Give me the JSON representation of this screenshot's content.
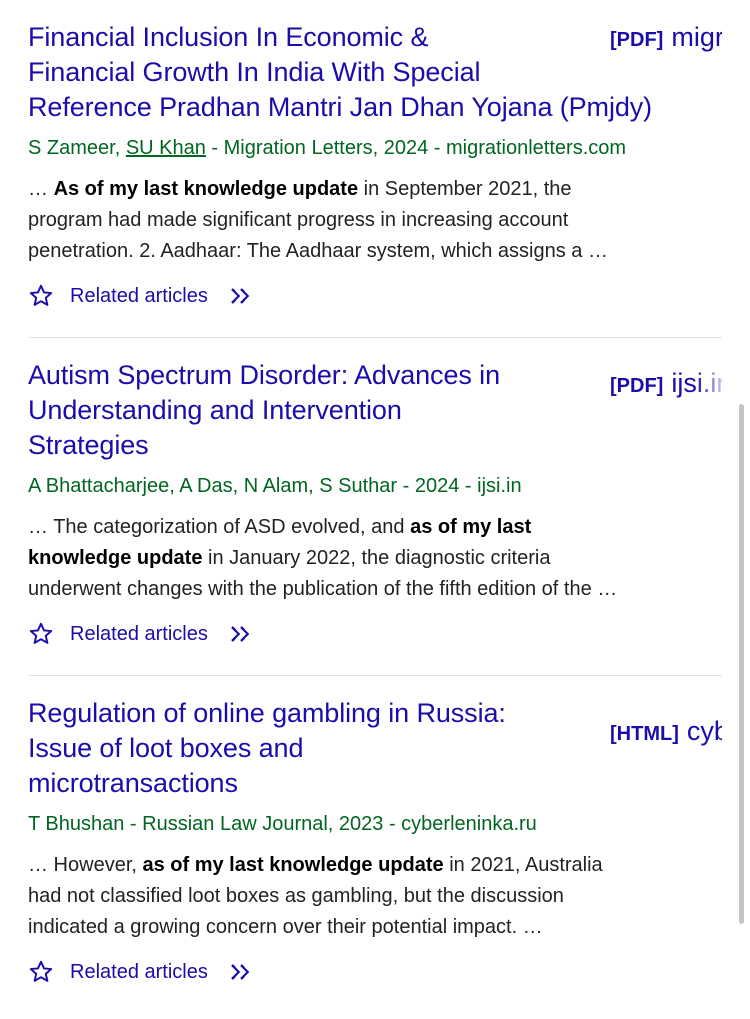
{
  "results": [
    {
      "title_lines": [
        "Financial Inclusion In Economic &",
        "Financial Growth In India With Special",
        "Reference Pradhan Mantri Jan Dhan Yojana (Pmjdy)"
      ],
      "fulltext_type": "[PDF]",
      "fulltext_domain": "migrationletters.com",
      "authors_before": "S Zameer, ",
      "author_link": "SU Khan",
      "authors_after": " - Migration Letters, 2024 - migrationletters.com",
      "snippet": {
        "l1_pre": "… ",
        "l1_bold": "As of my last knowledge update",
        "l1_post": " in September 2021, the",
        "l2": "program had made significant progress in increasing account",
        "l3": "penetration. 2. Aadhaar: The Aadhaar system, which assigns a …"
      },
      "related_label": "Related articles"
    },
    {
      "title_lines": [
        "Autism Spectrum Disorder: Advances in",
        "Understanding and Intervention",
        "Strategies"
      ],
      "fulltext_type": "[PDF]",
      "fulltext_domain": "ijsi.in",
      "authors": "A Bhattacharjee, A Das, N Alam, S Suthar - 2024 - ijsi.in",
      "snippet": {
        "l1_pre": "… The categorization of ASD evolved, and ",
        "l1_bold": "as of my last",
        "l2_bold": "knowledge update",
        "l2_post": " in January 2022, the diagnostic criteria",
        "l3": "underwent changes with the publication of the fifth edition of the …"
      },
      "related_label": "Related articles"
    },
    {
      "title_lines": [
        "Regulation of online gambling in Russia:",
        "Issue of loot boxes and",
        "microtransactions"
      ],
      "fulltext_type": "[HTML]",
      "fulltext_domain": "cyberleninka.ru",
      "authors": "T Bhushan - Russian Law Journal, 2023 - cyberleninka.ru",
      "snippet": {
        "l1_pre": "… However, ",
        "l1_bold": "as of my last knowledge update",
        "l1_post": " in 2021, Australia",
        "l2": "had not classified loot boxes as gambling, but the discussion",
        "l3": "indicated a growing concern over their potential impact. …"
      },
      "related_label": "Related articles"
    }
  ],
  "icons": {
    "star": "star-outline-icon",
    "more": "double-chevron-right-icon"
  },
  "colors": {
    "title": "#1a0dab",
    "authors": "#006621",
    "snippet": "#222222"
  }
}
